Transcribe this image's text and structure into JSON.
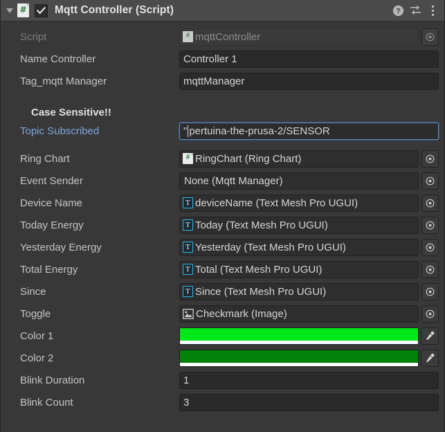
{
  "header": {
    "title": "Mqtt Controller (Script)",
    "enabled": true,
    "foldout_icon": "triangle-down-icon",
    "script_icon": "csharp-script-icon",
    "script_icon_glyph": "#",
    "help_icon": "help-icon",
    "preset_icon": "preset-sliders-icon",
    "menu_icon": "kebab-menu-icon"
  },
  "fields": {
    "script": {
      "label": "Script",
      "value": "mqttController",
      "icon": "csharp-script-icon",
      "disabled": true
    },
    "name_controller": {
      "label": "Name Controller",
      "value": "Controller 1"
    },
    "tag_mqtt_manager": {
      "label": "Tag_mqtt Manager",
      "value": "mqttManager"
    },
    "case_sensitive_heading": "Case Sensitive!!",
    "topic_subscribed": {
      "label": "Topic Subscribed",
      "value_prefix": "\"",
      "value": "pertuina-the-prusa-2/SENSOR",
      "focused": true,
      "label_color": "#7ba6db"
    },
    "ring_chart": {
      "label": "Ring Chart",
      "value": "RingChart (Ring Chart)",
      "icon": "csharp-script-icon"
    },
    "event_sender": {
      "label": "Event Sender",
      "value": "None (Mqtt Manager)",
      "icon": "none"
    },
    "device_name": {
      "label": "Device Name",
      "value": "deviceName (Text Mesh Pro UGUI)",
      "icon": "textmeshpro-icon"
    },
    "today_energy": {
      "label": "Today Energy",
      "value": "Today (Text Mesh Pro UGUI)",
      "icon": "textmeshpro-icon"
    },
    "yesterday_energy": {
      "label": "Yesterday Energy",
      "value": "Yesterday (Text Mesh Pro UGUI)",
      "icon": "textmeshpro-icon"
    },
    "total_energy": {
      "label": "Total Energy",
      "value": "Total (Text Mesh Pro UGUI)",
      "icon": "textmeshpro-icon"
    },
    "since": {
      "label": "Since",
      "value": "Since (Text Mesh Pro UGUI)",
      "icon": "textmeshpro-icon"
    },
    "toggle": {
      "label": "Toggle",
      "value": "Checkmark (Image)",
      "icon": "image-component-icon"
    },
    "color_1": {
      "label": "Color 1",
      "color": "#00E819",
      "alpha_color": "#FFFFFF",
      "eyedropper_icon": "eyedropper-icon"
    },
    "color_2": {
      "label": "Color 2",
      "color": "#00820A",
      "alpha_color": "#FFFFFF",
      "eyedropper_icon": "eyedropper-icon"
    },
    "blink_duration": {
      "label": "Blink Duration",
      "value": "1"
    },
    "blink_count": {
      "label": "Blink Count",
      "value": "3"
    }
  },
  "theme": {
    "panel_bg": "#383838",
    "header_bg": "#4b4b4b",
    "field_bg": "#2a2a2a",
    "object_field_bg": "#2e2e2e",
    "label_color": "#c4c4c4",
    "focus_border": "#5a87c9"
  }
}
